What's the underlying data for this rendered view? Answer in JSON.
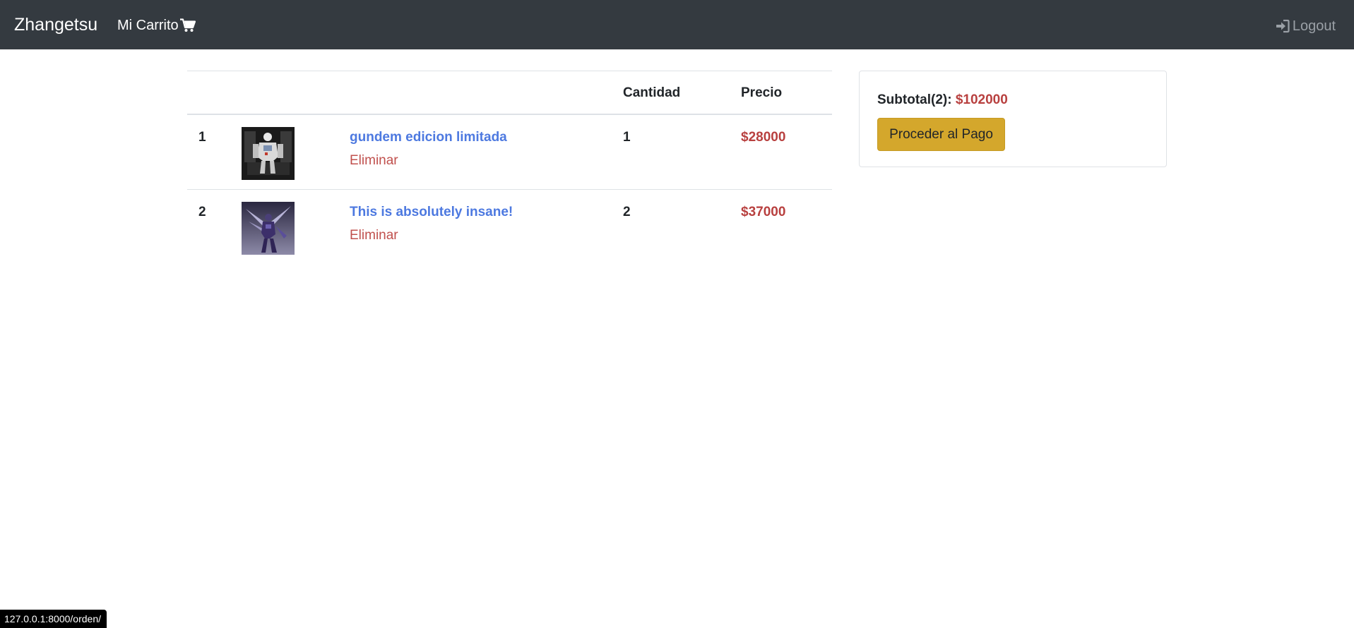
{
  "navbar": {
    "brand": "Zhangetsu",
    "cart_label": "Mi Carrito",
    "cart_icon": "shopping-cart-icon",
    "logout_label": "Logout",
    "logout_icon": "sign-in-icon"
  },
  "table": {
    "headers": [
      "",
      "",
      "",
      "Cantidad",
      "Precio"
    ],
    "rows": [
      {
        "index": "1",
        "name": "gundem edicion limitada",
        "remove_label": "Eliminar",
        "quantity": "1",
        "price": "$28000",
        "thumbnail": "white-mecha-figure-image"
      },
      {
        "index": "2",
        "name": "This is absolutely insane!",
        "remove_label": "Eliminar",
        "quantity": "2",
        "price": "$37000",
        "thumbnail": "purple-mecha-figure-image"
      }
    ]
  },
  "summary": {
    "subtotal_label": "Subtotal(2):",
    "subtotal_amount": "$102000",
    "pay_button": "Proceder al Pago"
  },
  "status_url": "127.0.0.1:8000/orden/",
  "colors": {
    "navbar_bg": "#343a40",
    "link_blue": "#4d79e0",
    "price_red": "#b8403f",
    "button_gold": "#d4a72c"
  }
}
